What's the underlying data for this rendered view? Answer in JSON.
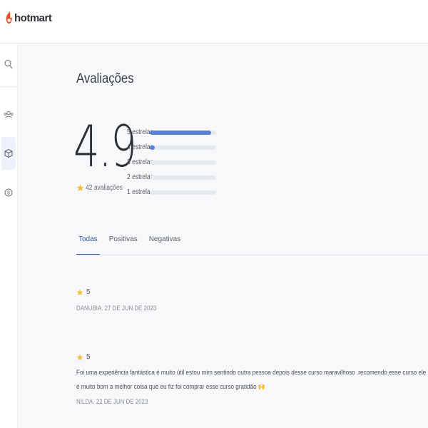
{
  "app": {
    "logo_text": "hotmart"
  },
  "sidebar": {
    "items": [
      {
        "name": "search",
        "icon": "search-icon"
      },
      {
        "name": "users",
        "icon": "users-icon"
      },
      {
        "name": "products",
        "icon": "box-icon",
        "active": true
      },
      {
        "name": "sales",
        "icon": "dollar-icon"
      }
    ]
  },
  "page": {
    "title": "Avaliações"
  },
  "summary": {
    "rating": "4.9",
    "count_label": "42 avaliações",
    "distribution": [
      {
        "label": "5 estrelas",
        "fraction": 0.93
      },
      {
        "label": "4 estrelas",
        "fraction": 0.07
      },
      {
        "label": "3 estrelas",
        "fraction": 0
      },
      {
        "label": "2 estrelas",
        "fraction": 0
      },
      {
        "label": "1 estrela",
        "fraction": 0
      }
    ]
  },
  "tabs": [
    {
      "label": "Todas",
      "active": true
    },
    {
      "label": "Positivas",
      "active": false
    },
    {
      "label": "Negativas",
      "active": false
    }
  ],
  "reviews": [
    {
      "stars": "5",
      "text": "",
      "meta": "DANUBIA. 27 DE JUN DE 2023"
    },
    {
      "stars": "5",
      "text": "Foi uma experiência fantástica é muito útil estou mim sentindo outra pessoa depois desse curso maravilhoso .recomendo esse curso ele é muito bom a melhor coisa que eu fiz foi comprar esse curso gratidão 🙌",
      "meta": "NILDA. 22 DE JUN DE 2023"
    }
  ],
  "colors": {
    "accent": "#35589e",
    "bar_fill": "#5a7fd6",
    "star": "#f2c23c",
    "brand": "#f04e23"
  }
}
